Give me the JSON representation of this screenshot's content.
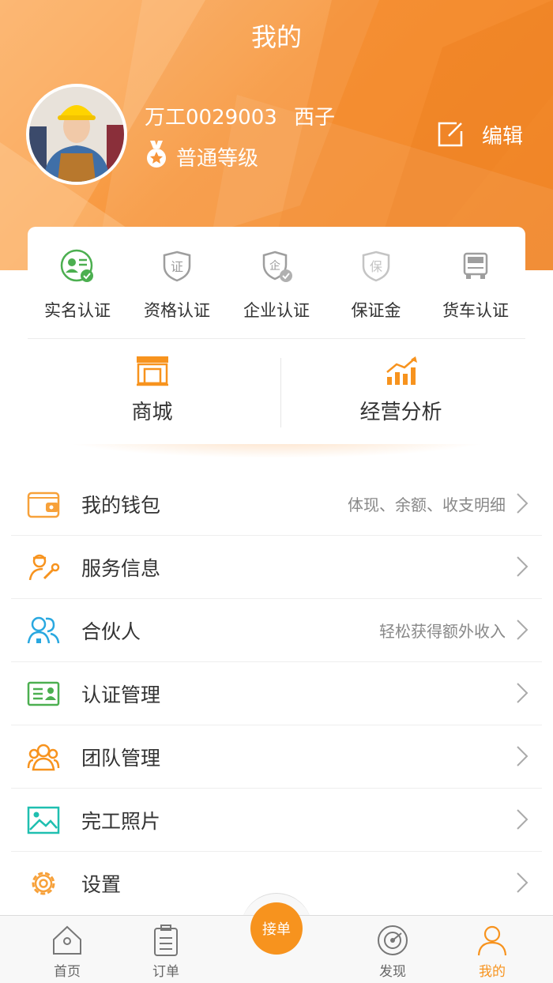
{
  "header": {
    "title": "我的",
    "user_id": "万工0029003",
    "nickname": "西子",
    "level": "普通等级",
    "edit_label": "编辑"
  },
  "certifications": [
    {
      "label": "实名认证",
      "icon": "realname-verified-icon",
      "color": "#4caf50"
    },
    {
      "label": "资格认证",
      "icon": "qualification-shield-icon",
      "color": "#9e9e9e"
    },
    {
      "label": "企业认证",
      "icon": "enterprise-shield-icon",
      "color": "#9e9e9e"
    },
    {
      "label": "保证金",
      "icon": "deposit-shield-icon",
      "color": "#bdbdbd"
    },
    {
      "label": "货车认证",
      "icon": "truck-icon",
      "color": "#9e9e9e"
    }
  ],
  "shortcuts": [
    {
      "label": "商城",
      "icon": "store-icon"
    },
    {
      "label": "经营分析",
      "icon": "analytics-chart-icon"
    }
  ],
  "menu": [
    {
      "label": "我的钱包",
      "hint": "体现、余额、收支明细",
      "icon": "wallet-icon"
    },
    {
      "label": "服务信息",
      "hint": "",
      "icon": "service-worker-icon"
    },
    {
      "label": "合伙人",
      "hint": "轻松获得额外收入",
      "icon": "partners-icon"
    },
    {
      "label": "认证管理",
      "hint": "",
      "icon": "id-card-icon"
    },
    {
      "label": "团队管理",
      "hint": "",
      "icon": "team-icon"
    },
    {
      "label": "完工照片",
      "hint": "",
      "icon": "photo-icon"
    },
    {
      "label": "设置",
      "hint": "",
      "icon": "settings-gear-icon"
    }
  ],
  "tabbar": {
    "home": "首页",
    "orders": "订单",
    "accept": "接单",
    "discover": "发现",
    "mine": "我的"
  },
  "colors": {
    "accent": "#f7931e",
    "header_orange": "#f7953a",
    "verified_green": "#4caf50"
  }
}
